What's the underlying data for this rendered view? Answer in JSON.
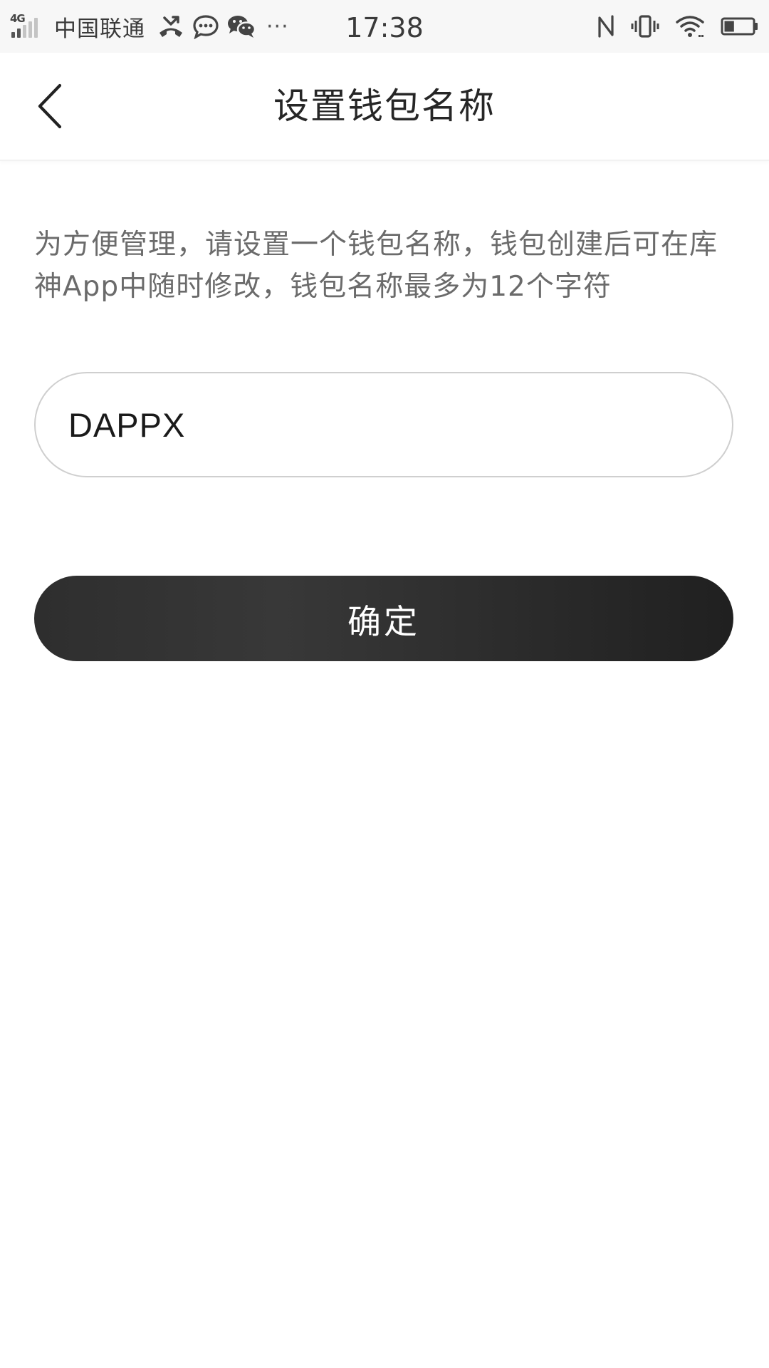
{
  "status_bar": {
    "network_type": "4G",
    "carrier": "中国联通",
    "more_indicator": "···",
    "time": "17:38",
    "left_icons": [
      "missed-call-icon",
      "message-bubble-icon",
      "wechat-icon"
    ],
    "right_icons": [
      "nfc-icon",
      "vibrate-icon",
      "wifi-icon",
      "battery-icon"
    ],
    "battery_level": 0.35
  },
  "nav": {
    "title": "设置钱包名称",
    "back_icon": "chevron-left-icon"
  },
  "content": {
    "description": "为方便管理，请设置一个钱包名称，钱包创建后可在库神App中随时修改，钱包名称最多为12个字符",
    "wallet_name_value": "DAPPX",
    "confirm_label": "确定"
  },
  "colors": {
    "button_background": "#2b2b2b",
    "button_text": "#ffffff",
    "input_border": "#cfcfcf",
    "description_text": "#6b6b6b",
    "title_text": "#262626",
    "status_bar_bg": "#f7f7f7"
  }
}
